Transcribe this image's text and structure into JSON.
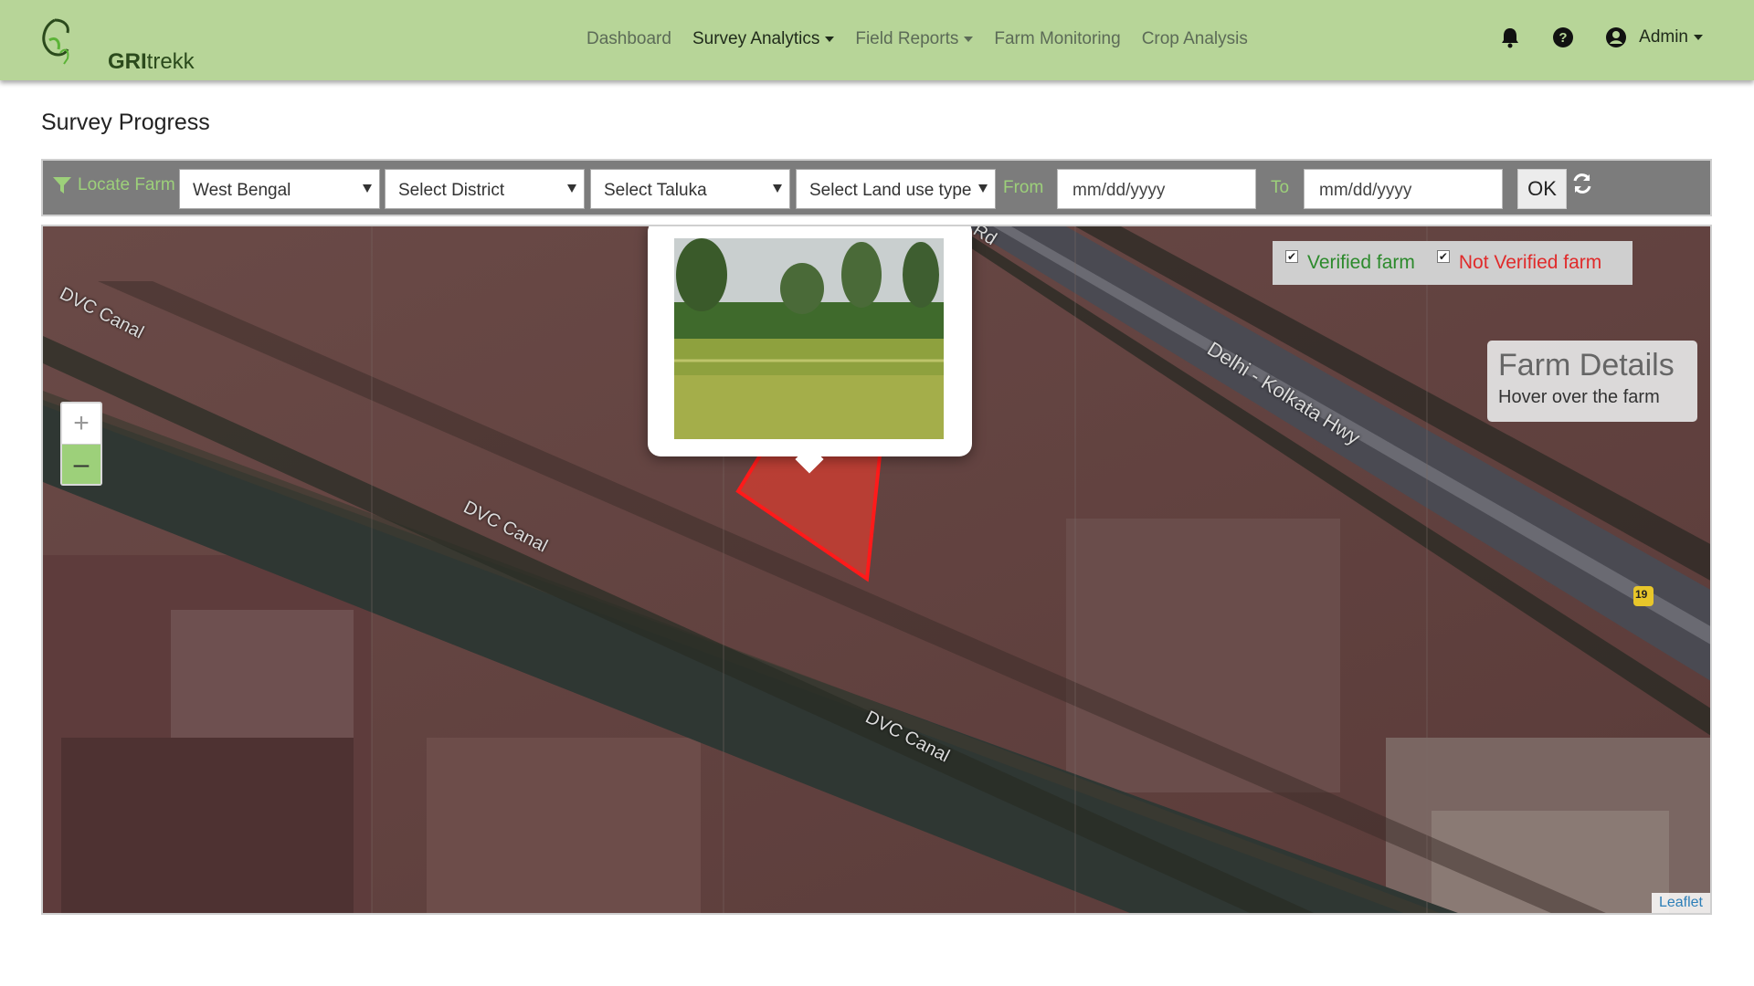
{
  "brand": {
    "logo_bold": "GRI",
    "logo_rest": "trekk"
  },
  "nav": {
    "items": [
      {
        "label": "Dashboard",
        "active": false,
        "dropdown": false
      },
      {
        "label": "Survey Analytics",
        "active": true,
        "dropdown": true
      },
      {
        "label": "Field Reports",
        "active": false,
        "dropdown": true
      },
      {
        "label": "Farm Monitoring",
        "active": false,
        "dropdown": false
      },
      {
        "label": "Crop Analysis",
        "active": false,
        "dropdown": false
      }
    ],
    "user": "Admin",
    "icons": [
      "bell-icon",
      "help-icon",
      "user-icon"
    ]
  },
  "page": {
    "title": "Survey Progress"
  },
  "filters": {
    "locate_label": "Locate Farm",
    "state": "West Bengal",
    "district": "Select District",
    "taluka": "Select Taluka",
    "land_use": "Select Land use type",
    "from_label": "From",
    "from_placeholder": "mm/dd/yyyy",
    "to_label": "To",
    "to_placeholder": "mm/dd/yyyy",
    "ok_label": "OK"
  },
  "map": {
    "labels": {
      "canal_1": "DVC Canal",
      "canal_2": "DVC Canal",
      "canal_3": "DVC Canal",
      "highway": "Delhi - Kolkata Hwy",
      "road_end": "Rd",
      "route_badge": "19"
    },
    "zoom_in": "+",
    "zoom_out": "–",
    "legend": {
      "verified": "Verified farm",
      "not_verified": "Not Verified farm"
    },
    "details": {
      "title": "Farm Details",
      "hint": "Hover over the farm"
    },
    "attribution": "Leaflet"
  },
  "colors": {
    "navbar": "#b7d598",
    "accent_green": "#9dd07a",
    "verified": "#2c8a2c",
    "not_verified": "#e02a2a",
    "farm_polygon": "#ff1a1a"
  }
}
